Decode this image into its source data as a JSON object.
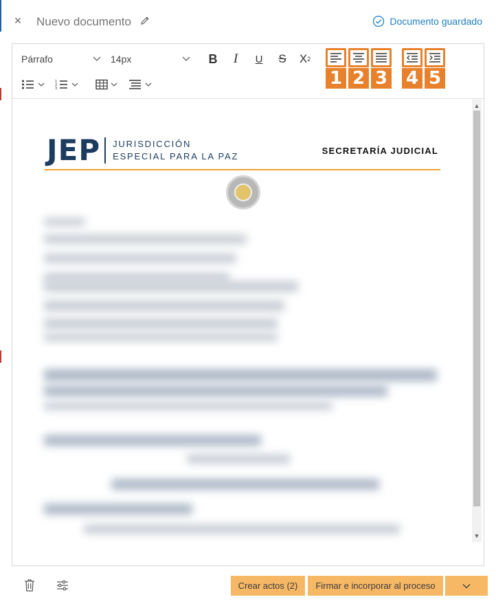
{
  "header": {
    "title": "Nuevo documento",
    "status": "Documento guardado",
    "close_glyph": "×",
    "icons": {
      "close": "close-icon",
      "edit": "pencil-icon",
      "status": "check-circle-icon"
    }
  },
  "toolbar": {
    "paragraph_style": "Párrafo",
    "font_size": "14px",
    "bold": "B",
    "italic": "I",
    "underline": "U",
    "strikethrough": "S",
    "superscript_base": "X",
    "superscript_exp": "2",
    "callouts": [
      "1",
      "2",
      "3",
      "4",
      "5"
    ],
    "alignment_buttons": [
      "align-left",
      "align-center",
      "justify",
      "outdent",
      "indent"
    ],
    "row2_buttons": [
      "bullet-list",
      "numbered-list",
      "table",
      "line-spacing"
    ]
  },
  "document": {
    "logo_letters": "JEP",
    "logo_line1": "JURISDICCIÓN",
    "logo_line2": "ESPECIAL PARA LA PAZ",
    "heading_right": "SECRETARÍA JUDICIAL",
    "accent_color": "#f0a030",
    "body_blurred": true
  },
  "footer": {
    "crear_label": "Crear actos (2)",
    "firmar_label": "Firmar e incorporar al proceso",
    "icons": {
      "delete": "trash-icon",
      "settings": "sliders-icon",
      "dropdown": "chevron-down-icon"
    },
    "button_color": "#f7b866"
  },
  "colors": {
    "accent_orange": "#e8812c",
    "link_blue": "#1f7fc4"
  }
}
